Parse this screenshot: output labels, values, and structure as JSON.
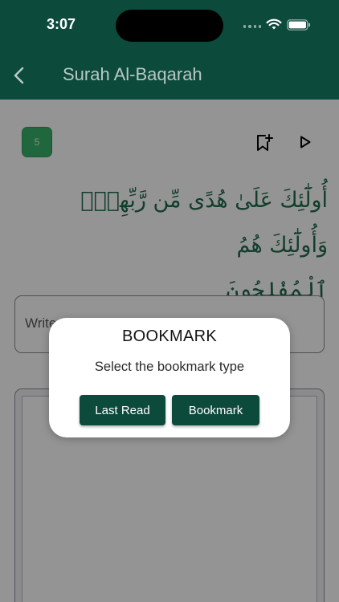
{
  "status_bar": {
    "time": "3:07"
  },
  "app_bar": {
    "title": "Surah Al-Baqarah",
    "back_icon": "chevron-left-icon"
  },
  "verse": {
    "number": "5",
    "arabic_line1": "أُولَٰٓئِكَ عَلَىٰ هُدًى مِّن رَّبِّهِمْۖ وَأُولَٰٓئِكَ هُمُ",
    "arabic_line2": "ٱلْمُفْلِحُونَ",
    "actions": [
      "bookmark-add-icon",
      "play-icon"
    ],
    "accent_color": "#1f6b4c"
  },
  "note": {
    "placeholder": "Write"
  },
  "dialog": {
    "title": "BOOKMARK",
    "message": "Select the bookmark type",
    "buttons": [
      "Last Read",
      "Bookmark"
    ]
  },
  "colors": {
    "brand": "#0c4a3c",
    "badge": "#3ab26a"
  }
}
